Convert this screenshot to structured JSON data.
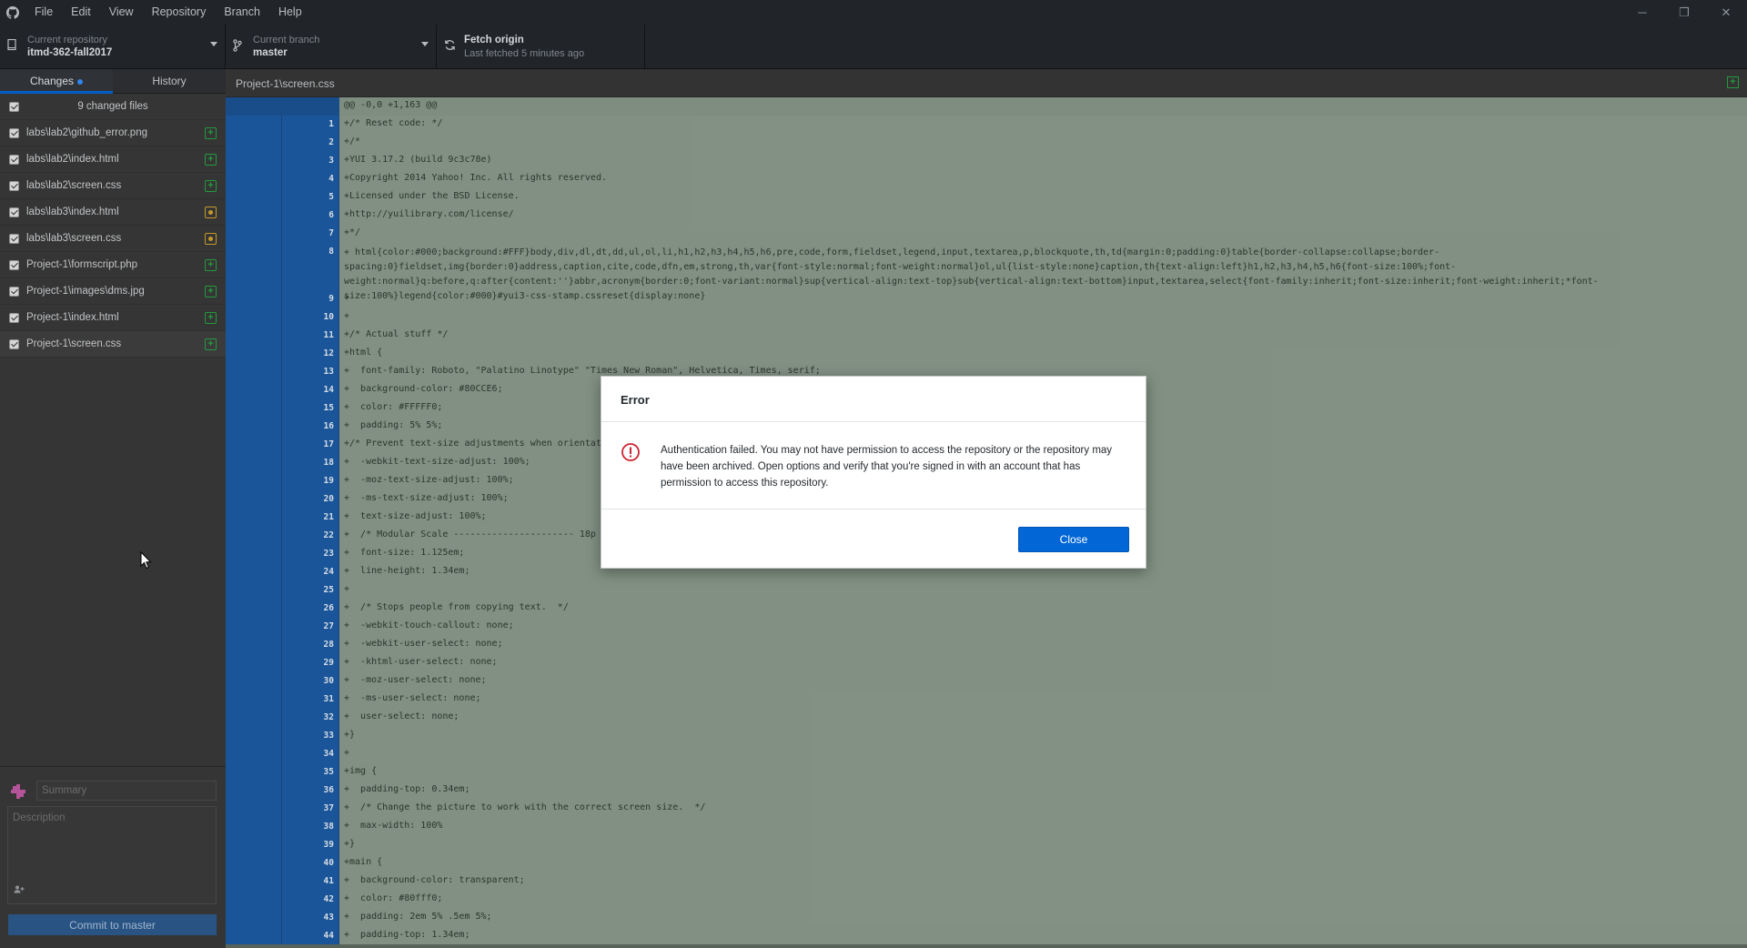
{
  "menu": [
    "File",
    "Edit",
    "View",
    "Repository",
    "Branch",
    "Help"
  ],
  "window_controls": {
    "minimize": "─",
    "restore": "❐",
    "close": "✕"
  },
  "toolbar": {
    "repo_sub": "Current repository",
    "repo_name": "itmd-362-fall2017",
    "branch_sub": "Current branch",
    "branch_name": "master",
    "fetch_main": "Fetch origin",
    "fetch_sub": "Last fetched 5 minutes ago"
  },
  "tabs": {
    "changes": "Changes",
    "history": "History"
  },
  "changed_header": "9 changed files",
  "files": [
    {
      "name": "labs\\lab2\\github_error.png",
      "status": "added"
    },
    {
      "name": "labs\\lab2\\index.html",
      "status": "added"
    },
    {
      "name": "labs\\lab2\\screen.css",
      "status": "added"
    },
    {
      "name": "labs\\lab3\\index.html",
      "status": "modified"
    },
    {
      "name": "labs\\lab3\\screen.css",
      "status": "modified"
    },
    {
      "name": "Project-1\\formscript.php",
      "status": "added"
    },
    {
      "name": "Project-1\\images\\dms.jpg",
      "status": "added"
    },
    {
      "name": "Project-1\\index.html",
      "status": "added"
    },
    {
      "name": "Project-1\\screen.css",
      "status": "added"
    }
  ],
  "commit": {
    "summary_placeholder": "Summary",
    "description_placeholder": "Description",
    "button": "Commit to master"
  },
  "diff": {
    "file_path": "Project-1\\screen.css",
    "hunk_header": "@@ -0,0 +1,163 @@",
    "lines": [
      {
        "n": "1",
        "code": "+/* Reset code: */"
      },
      {
        "n": "2",
        "code": "+/*"
      },
      {
        "n": "3",
        "code": "+YUI 3.17.2 (build 9c3c78e)"
      },
      {
        "n": "4",
        "code": "+Copyright 2014 Yahoo! Inc. All rights reserved."
      },
      {
        "n": "5",
        "code": "+Licensed under the BSD License."
      },
      {
        "n": "6",
        "code": "+http://yuilibrary.com/license/"
      },
      {
        "n": "7",
        "code": "+*/"
      },
      {
        "n": "8",
        "code": "+ html{color:#000;background:#FFF}body,div,dl,dt,dd,ul,ol,li,h1,h2,h3,h4,h5,h6,pre,code,form,fieldset,legend,input,textarea,p,blockquote,th,td{margin:0;padding:0}table{border-collapse:collapse;border-spacing:0}fieldset,img{border:0}address,caption,cite,code,dfn,em,strong,th,var{font-style:normal;font-weight:normal}ol,ul{list-style:none}caption,th{text-align:left}h1,h2,h3,h4,h5,h6{font-size:100%;font-weight:normal}q:before,q:after{content:''}abbr,acronym{border:0;font-variant:normal}sup{vertical-align:text-top}sub{vertical-align:text-bottom}input,textarea,select{font-family:inherit;font-size:inherit;font-weight:inherit;*font-size:100%}legend{color:#000}#yui3-css-stamp.cssreset{display:none}",
        "wrap": true
      },
      {
        "n": "9",
        "code": "+"
      },
      {
        "n": "10",
        "code": "+"
      },
      {
        "n": "11",
        "code": "+/* Actual stuff */"
      },
      {
        "n": "12",
        "code": "+html {"
      },
      {
        "n": "13",
        "code": "+  font-family: Roboto, \"Palatino Linotype\" \"Times New Roman\", Helvetica, Times, serif;"
      },
      {
        "n": "14",
        "code": "+  background-color: #80CCE6;"
      },
      {
        "n": "15",
        "code": "+  color: #FFFFF0;"
      },
      {
        "n": "16",
        "code": "+  padding: 5% 5%;"
      },
      {
        "n": "17",
        "code": "+/* Prevent text-size adjustments when orientat"
      },
      {
        "n": "18",
        "code": "+  -webkit-text-size-adjust: 100%;"
      },
      {
        "n": "19",
        "code": "+  -moz-text-size-adjust: 100%;"
      },
      {
        "n": "20",
        "code": "+  -ms-text-size-adjust: 100%;"
      },
      {
        "n": "21",
        "code": "+  text-size-adjust: 100%;"
      },
      {
        "n": "22",
        "code": "+  /* Modular Scale ---------------------- 18p"
      },
      {
        "n": "23",
        "code": "+  font-size: 1.125em;"
      },
      {
        "n": "24",
        "code": "+  line-height: 1.34em;"
      },
      {
        "n": "25",
        "code": "+"
      },
      {
        "n": "26",
        "code": "+  /* Stops people from copying text.  */"
      },
      {
        "n": "27",
        "code": "+  -webkit-touch-callout: none;"
      },
      {
        "n": "28",
        "code": "+  -webkit-user-select: none;"
      },
      {
        "n": "29",
        "code": "+  -khtml-user-select: none;"
      },
      {
        "n": "30",
        "code": "+  -moz-user-select: none;"
      },
      {
        "n": "31",
        "code": "+  -ms-user-select: none;"
      },
      {
        "n": "32",
        "code": "+  user-select: none;"
      },
      {
        "n": "33",
        "code": "+}"
      },
      {
        "n": "34",
        "code": "+"
      },
      {
        "n": "35",
        "code": "+img {"
      },
      {
        "n": "36",
        "code": "+  padding-top: 0.34em;"
      },
      {
        "n": "37",
        "code": "+  /* Change the picture to work with the correct screen size.  */"
      },
      {
        "n": "38",
        "code": "+  max-width: 100%"
      },
      {
        "n": "39",
        "code": "+}"
      },
      {
        "n": "40",
        "code": "+main {"
      },
      {
        "n": "41",
        "code": "+  background-color: transparent;"
      },
      {
        "n": "42",
        "code": "+  color: #80fff0;"
      },
      {
        "n": "43",
        "code": "+  padding: 2em 5% .5em 5%;"
      },
      {
        "n": "44",
        "code": "+  padding-top: 1.34em;"
      }
    ]
  },
  "dialog": {
    "title": "Error",
    "message": "Authentication failed. You may not have permission to access the repository or the repository may have been archived. Open options and verify that you're signed in with an account that has permission to access this repository.",
    "close_button": "Close"
  },
  "colors": {
    "accent": "#0366d6",
    "added": "#28a745",
    "modified": "#d4a72c",
    "error": "#cb2431"
  }
}
